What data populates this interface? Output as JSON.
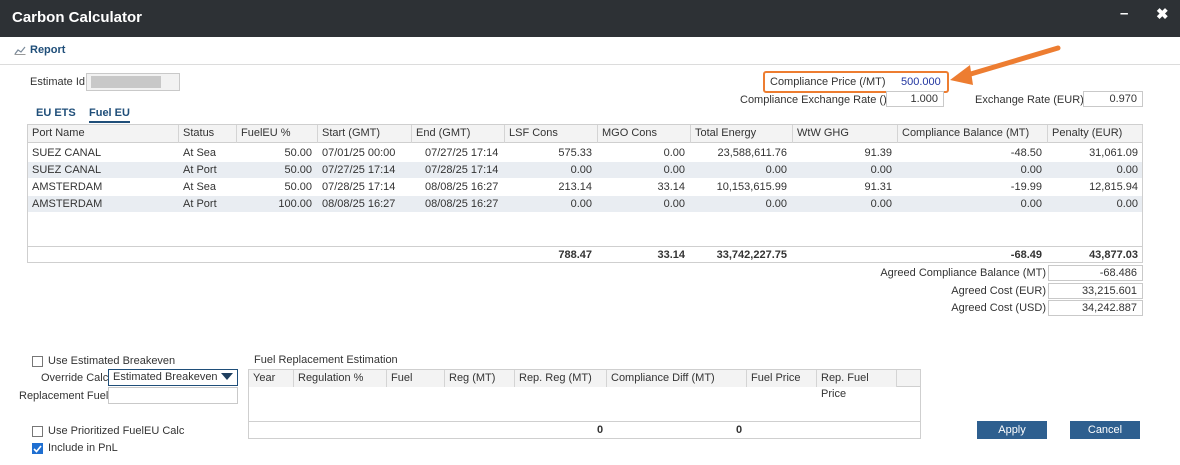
{
  "window": {
    "title": "Carbon Calculator",
    "minimize": "–",
    "close": "✖"
  },
  "toolbar": {
    "report_label": "Report",
    "report_icon": "chart-icon"
  },
  "estimate": {
    "label": "Estimate Id",
    "value": ""
  },
  "compliance": {
    "price_label": "Compliance Price (/MT)",
    "price_value": "500.000",
    "exchange_rate_label": "Compliance Exchange Rate ()",
    "exchange_rate_value": "1.000",
    "eur_rate_label": "Exchange Rate (EUR)",
    "eur_rate_value": "0.970",
    "highlight_color": "#ed7d31"
  },
  "tabs": [
    {
      "label": "EU ETS"
    },
    {
      "label": "Fuel EU"
    }
  ],
  "grid": {
    "columns": [
      "Port Name",
      "Status",
      "FuelEU %",
      "Start (GMT)",
      "End (GMT)",
      "LSF Cons",
      "MGO Cons",
      "Total Energy",
      "WtW GHG",
      "Compliance Balance (MT)",
      "Penalty (EUR)"
    ],
    "rows": [
      [
        "SUEZ CANAL",
        "At Sea",
        "50.00",
        "07/01/25 00:00",
        "07/27/25 17:14",
        "575.33",
        "0.00",
        "23,588,611.76",
        "91.39",
        "-48.50",
        "31,061.09"
      ],
      [
        "SUEZ CANAL",
        "At Port",
        "50.00",
        "07/27/25 17:14",
        "07/28/25 17:14",
        "0.00",
        "0.00",
        "0.00",
        "0.00",
        "0.00",
        "0.00"
      ],
      [
        "AMSTERDAM",
        "At Sea",
        "50.00",
        "07/28/25 17:14",
        "08/08/25 16:27",
        "213.14",
        "33.14",
        "10,153,615.99",
        "91.31",
        "-19.99",
        "12,815.94"
      ],
      [
        "AMSTERDAM",
        "At Port",
        "100.00",
        "08/08/25 16:27",
        "08/08/25 16:27",
        "0.00",
        "0.00",
        "0.00",
        "0.00",
        "0.00",
        "0.00"
      ]
    ],
    "totals": {
      "lsf": "788.47",
      "mgo": "33.14",
      "energy": "33,742,227.75",
      "balance": "-68.49",
      "penalty": "43,877.03"
    }
  },
  "agreed": {
    "balance_label": "Agreed Compliance Balance (MT)",
    "balance_value": "-68.486",
    "cost_eur_label": "Agreed Cost (EUR)",
    "cost_eur_value": "33,215.601",
    "cost_usd_label": "Agreed Cost (USD)",
    "cost_usd_value": "34,242.887"
  },
  "options": {
    "use_breakeven_label": "Use Estimated Breakeven",
    "override_label": "Override Calc",
    "override_value": "Estimated Breakeven",
    "replacement_fuel_label": "Replacement Fuel",
    "use_prioritized_label": "Use Prioritized FuelEU Calc",
    "include_pnl_label": "Include in PnL"
  },
  "fuel_replacement": {
    "title": "Fuel Replacement Estimation",
    "columns": [
      "Year",
      "Regulation %",
      "Fuel",
      "Reg (MT)",
      "Rep. Reg (MT)",
      "Compliance Diff (MT)",
      "Fuel Price",
      "Rep. Fuel Price"
    ],
    "totals": {
      "rep_reg": "0",
      "compliance_diff": "0"
    }
  },
  "buttons": {
    "apply": "Apply",
    "cancel": "Cancel",
    "color": "#2e5f8f"
  }
}
